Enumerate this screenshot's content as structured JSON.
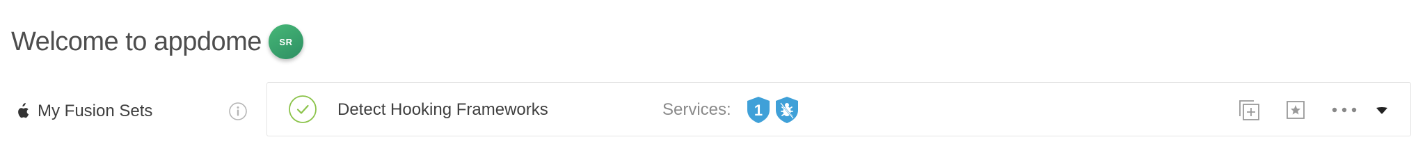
{
  "header": {
    "welcome_text": "Welcome to appdome",
    "avatar_initials": "SR",
    "avatar_color": "#3aa66f"
  },
  "sidebar": {
    "platform_icon": "apple-icon",
    "label": "My Fusion Sets",
    "info_icon": "info-icon"
  },
  "fusion_set": {
    "status_icon": "check-circle-icon",
    "status_color": "#8bc34a",
    "name": "Detect Hooking Frameworks",
    "services_label": "Services:",
    "services": [
      {
        "icon": "shield-number-icon",
        "text": "1",
        "color": "#3fa0d8"
      },
      {
        "icon": "shield-bug-icon",
        "color": "#3fa0d8"
      }
    ],
    "actions": [
      "copy-add-icon",
      "star-icon",
      "more-icon",
      "chevron-down-icon"
    ]
  }
}
